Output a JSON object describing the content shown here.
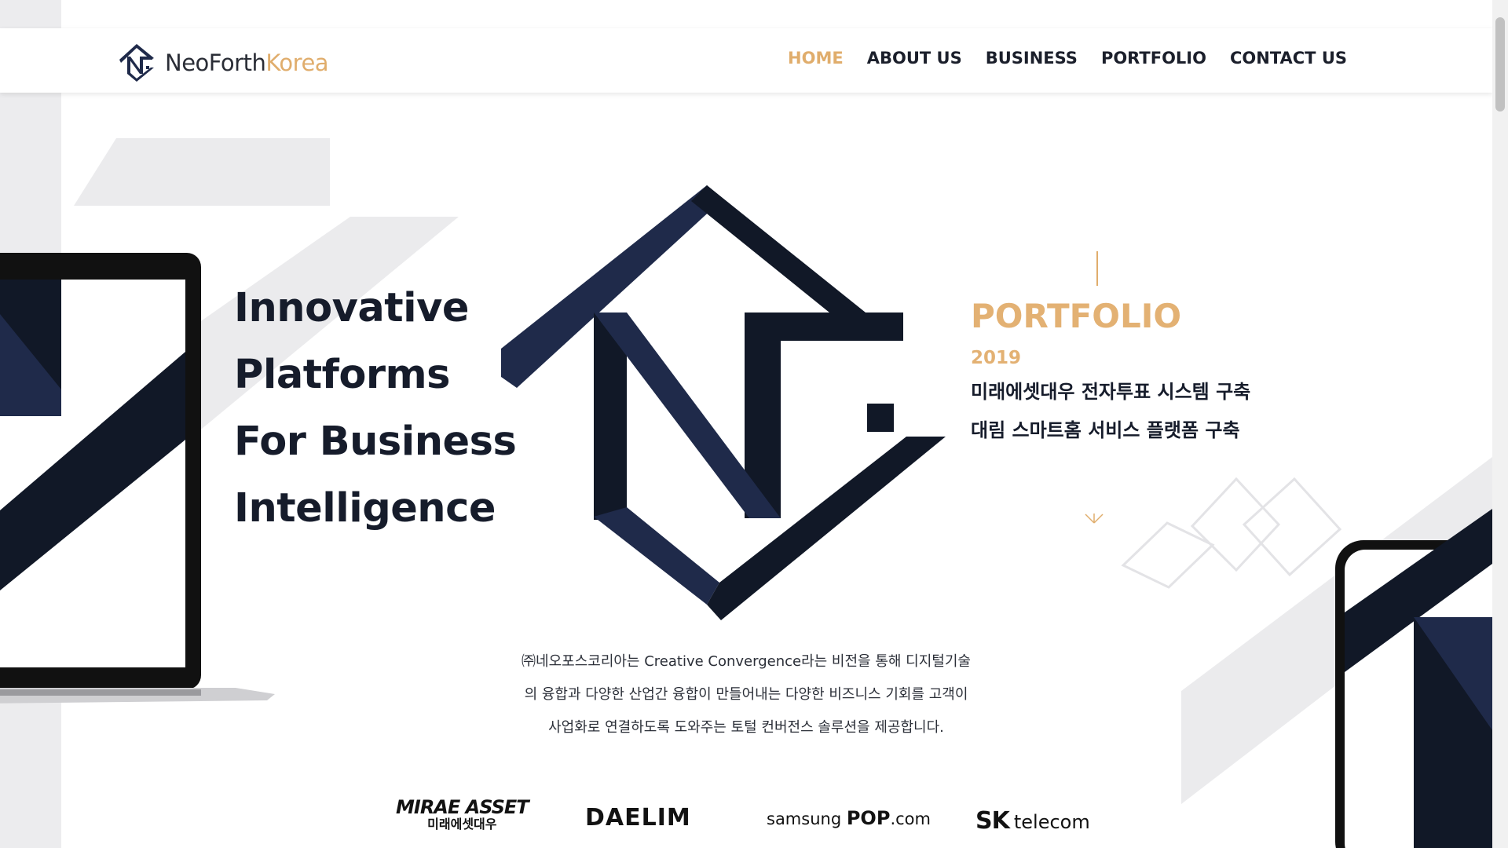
{
  "brand": {
    "name_main": "NeoForth",
    "name_accent": "Korea"
  },
  "nav": {
    "items": [
      {
        "label": "HOME",
        "active": true
      },
      {
        "label": "ABOUT US",
        "active": false
      },
      {
        "label": "BUSINESS",
        "active": false
      },
      {
        "label": "PORTFOLIO",
        "active": false
      },
      {
        "label": "CONTACT US",
        "active": false
      }
    ]
  },
  "hero": {
    "lines": [
      "Innovative",
      "Platforms",
      "For Business",
      "Intelligence"
    ]
  },
  "portfolio": {
    "title": "PORTFOLIO",
    "year": "2019",
    "items": [
      "미래에셋대우 전자투표 시스템 구축",
      "대림 스마트홈 서비스 플랫폼 구축"
    ]
  },
  "intro": {
    "lines": [
      "㈜네오포스코리아는 Creative Convergence라는 비전을 통해 디지털기술",
      "의 융합과 다양한 산업간 융합이 만들어내는 다양한 비즈니스 기회를 고객이",
      "사업화로 연결하도록 도와주는 토털 컨버전스 솔루션을 제공합니다."
    ]
  },
  "clients": {
    "mirae_main": "MIRAE ASSET",
    "mirae_sub": "미래에셋대우",
    "daelim": "DAELIM",
    "samsung_prefix": "samsung ",
    "samsung_bold": "POP",
    "samsung_suffix": ".com",
    "sk": "SK",
    "sk_telecom": "telecom"
  },
  "colors": {
    "accent": "#e0ad6c",
    "navy_dark": "#111827",
    "navy_mid": "#1f2a4a",
    "gray_shape": "#e9e9eb"
  },
  "icons": {
    "logo": "nf-monogram-icon",
    "scroll": "chevron-down-icon"
  }
}
